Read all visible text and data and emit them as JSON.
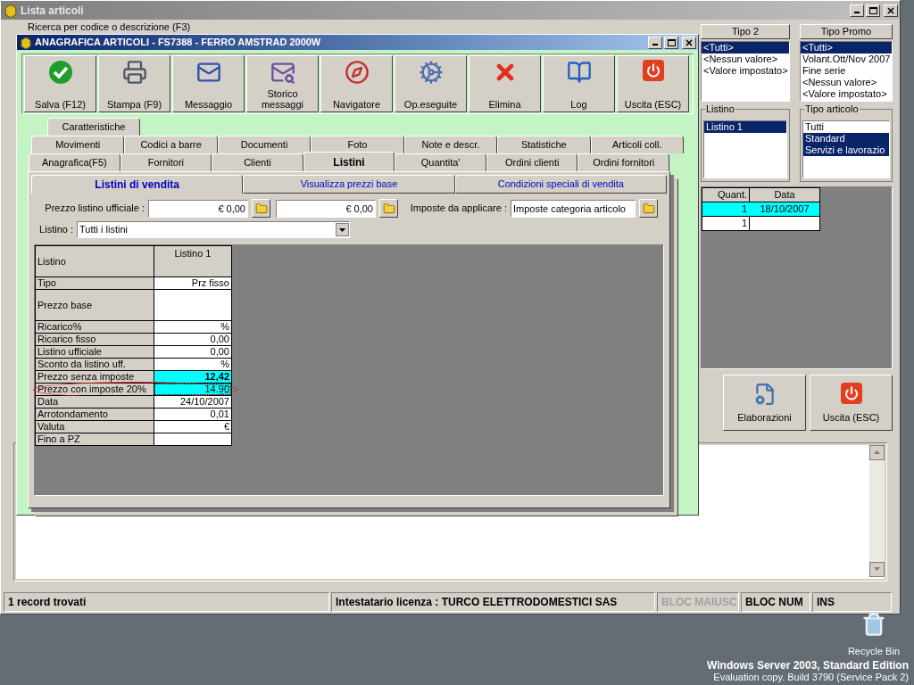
{
  "main_window": {
    "title": "Lista articoli",
    "search_label": "Ricerca per codice o descrizione (F3)",
    "filters": [
      {
        "kind": "header",
        "title": "Tipo 2",
        "items": [
          {
            "label": "<Tutti>",
            "selected": true
          },
          {
            "label": "<Nessun valore>",
            "selected": false
          },
          {
            "label": "<Valore impostato>",
            "selected": false
          }
        ]
      },
      {
        "kind": "header",
        "title": "Tipo Promo",
        "items": [
          {
            "label": "<Tutti>",
            "selected": true
          },
          {
            "label": "Volant.Ott/Nov 2007",
            "selected": false
          },
          {
            "label": "Fine serie",
            "selected": false
          },
          {
            "label": "<Nessun valore>",
            "selected": false
          },
          {
            "label": "<Valore impostato>",
            "selected": false
          }
        ]
      },
      {
        "kind": "group",
        "title": "Listino",
        "items": [
          {
            "label": "Listino 1",
            "selected": true
          }
        ]
      },
      {
        "kind": "group",
        "title": "Tipo articolo",
        "items": [
          {
            "label": "Tutti",
            "selected": false
          },
          {
            "label": "Standard",
            "selected": true
          },
          {
            "label": "Servizi e lavorazio",
            "selected": true
          }
        ]
      }
    ],
    "grid": {
      "columns": [
        "Quant.",
        "Data"
      ],
      "rows": [
        {
          "cells": [
            "1",
            "18/10/2007"
          ],
          "selected": true
        },
        {
          "cells": [
            "1"
          ],
          "selected": false
        }
      ]
    },
    "buttons": [
      {
        "label": "Elaborazioni"
      },
      {
        "label": "Uscita (ESC)"
      }
    ]
  },
  "dialog": {
    "title": "ANAGRAFICA ARTICOLI - FS7388 - FERRO AMSTRAD 2000W",
    "toolbar": [
      {
        "label": "Salva (F12)"
      },
      {
        "label": "Stampa (F9)"
      },
      {
        "label": "Messaggio"
      },
      {
        "label": "Storico messaggi"
      },
      {
        "label": "Navigatore"
      },
      {
        "label": "Op.eseguite"
      },
      {
        "label": "Elimina"
      },
      {
        "label": "Log"
      },
      {
        "label": "Uscita (ESC)"
      }
    ],
    "tab_rows": [
      [
        {
          "label": "Caratteristiche",
          "selected": false
        }
      ],
      [
        {
          "label": "Movimenti",
          "selected": false
        },
        {
          "label": "Codici a barre",
          "selected": false
        },
        {
          "label": "Documenti",
          "selected": false
        },
        {
          "label": "Foto",
          "selected": false
        },
        {
          "label": "Note e descr.",
          "selected": false
        },
        {
          "label": "Statistiche",
          "selected": false
        },
        {
          "label": "Articoli coll.",
          "selected": false
        }
      ],
      [
        {
          "label": "Anagrafica(F5)",
          "selected": false
        },
        {
          "label": "Fornitori",
          "selected": false
        },
        {
          "label": "Clienti",
          "selected": false
        },
        {
          "label": "Listini",
          "selected": true
        },
        {
          "label": "Quantita'",
          "selected": false
        },
        {
          "label": "Ordini clienti",
          "selected": false
        },
        {
          "label": "Ordini fornitori",
          "selected": false
        }
      ]
    ],
    "subtabs": [
      {
        "label": "Listini di vendita",
        "selected": true
      },
      {
        "label": "Visualizza prezzi base",
        "selected": false
      },
      {
        "label": "Condizioni speciali di vendita",
        "selected": false
      }
    ],
    "form": {
      "price_label": "Prezzo listino ufficiale :",
      "price_values": [
        "€ 0,00",
        "€ 0,00"
      ],
      "tax_label": "Imposte da applicare :",
      "tax_value": "Imposte categoria articolo",
      "list_label": "Listino :",
      "list_value": "Tutti i listini"
    },
    "price_table": {
      "header": [
        "Listino",
        "Listino 1"
      ],
      "rows": [
        {
          "label": "Tipo",
          "value": "Prz fisso",
          "tall": false,
          "highlight": false
        },
        {
          "label": "Prezzo base",
          "tall": true,
          "highlight": false
        },
        {
          "label": "Ricarico%",
          "value": "%",
          "tall": false,
          "highlight": false
        },
        {
          "label": "Ricarico fisso",
          "value": "0,00",
          "tall": false,
          "highlight": false
        },
        {
          "label": "Listino ufficiale",
          "value": "0,00",
          "tall": false,
          "highlight": false
        },
        {
          "label": "Sconto da listino uff.",
          "value": "%",
          "tall": false,
          "highlight": false
        },
        {
          "label": "Prezzo senza imposte",
          "value": "12,42",
          "tall": false,
          "highlight": true,
          "bold": true
        },
        {
          "label": "Prezzo con imposte 20%",
          "value": "14.90",
          "tall": false,
          "highlight": true,
          "focused": true,
          "circled": true
        },
        {
          "label": "Data",
          "value": "24/10/2007",
          "tall": false,
          "highlight": false
        },
        {
          "label": "Arrotondamento",
          "value": "0,01",
          "tall": false,
          "highlight": false
        },
        {
          "label": "Valuta",
          "value": "€",
          "tall": false,
          "highlight": false
        },
        {
          "label": "Fino a PZ",
          "tall": false,
          "highlight": false
        }
      ]
    }
  },
  "status_bar": [
    {
      "text": "1 record trovati",
      "disabled": false
    },
    {
      "text": "Intestatario licenza : TURCO ELETTRODOMESTICI SAS",
      "disabled": false
    },
    {
      "text": "BLOC MAIUSC",
      "disabled": true
    },
    {
      "text": "BLOC NUM",
      "disabled": false
    },
    {
      "text": "INS",
      "disabled": false
    }
  ],
  "desktop": {
    "recycle_bin": "Recycle Bin",
    "os_lines": [
      "Windows Server 2003, Standard Edition",
      "Evaluation copy. Build 3790 (Service Pack 2)"
    ]
  }
}
